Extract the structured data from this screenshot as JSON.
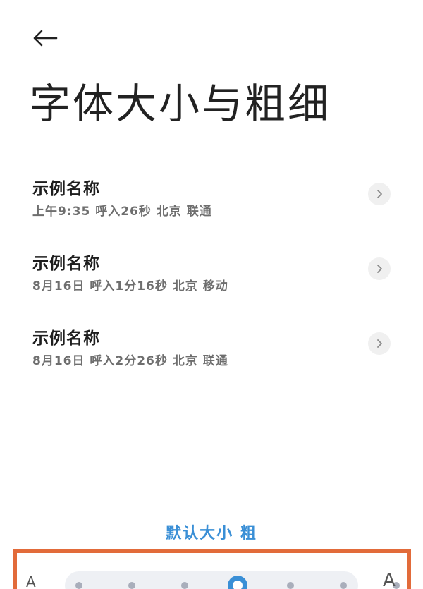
{
  "header": {
    "back_icon": "arrow-left-icon",
    "title": "字体大小与粗细"
  },
  "calls": [
    {
      "name": "示例名称",
      "detail": "上午9:35 呼入26秒 北京 联通",
      "action_icon": "chevron-right-icon"
    },
    {
      "name": "示例名称",
      "detail": "8月16日 呼入1分16秒 北京 移动",
      "action_icon": "chevron-right-icon"
    },
    {
      "name": "示例名称",
      "detail": "8月16日 呼入2分26秒 北京 联通",
      "action_icon": "chevron-right-icon"
    }
  ],
  "size_setting": {
    "label": "默认大小 粗",
    "small_marker": "A",
    "large_marker": "A",
    "steps": 7,
    "selected_step": 3
  },
  "colors": {
    "accent": "#3a8fd6",
    "highlight_border": "#e26b3a",
    "title_text": "#222222",
    "secondary_text": "#6e6e6e"
  }
}
